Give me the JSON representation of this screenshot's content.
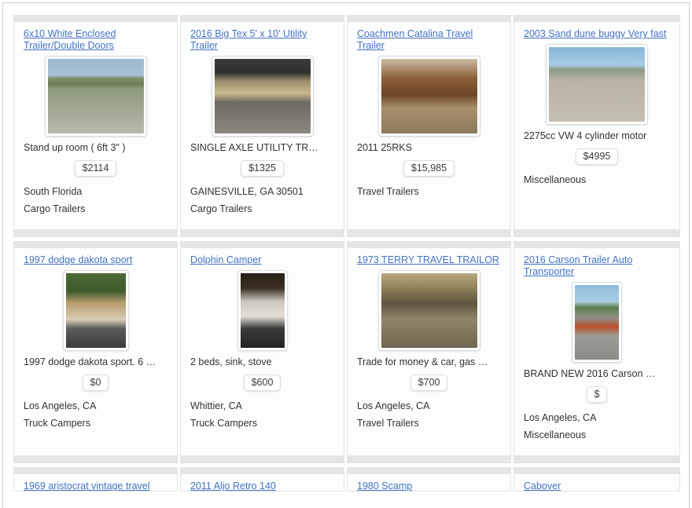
{
  "page": {
    "layout": "classifieds-grid",
    "columns": 4,
    "accent_link_color": "#4573c4",
    "card_bar_color": "#e5e5e5",
    "card_background": "#fcfdfd"
  },
  "rows": [
    {
      "cards": [
        {
          "title": "6x10 White Enclosed Trailer/Double Doors",
          "description": "Stand up room ( 6ft 3\" )",
          "price": "$2114",
          "location": "South Florida",
          "category": "Cargo Trailers",
          "thumb_alt": "white-enclosed-cargo-trailer-photo",
          "thumb_w": 122,
          "thumb_h": 95
        },
        {
          "title": "2016 Big Tex 5' x 10' Utility Trailer",
          "description": "SINGLE AXLE UTILITY TR…",
          "price": "$1325",
          "location": "GAINESVILLE, GA 30501",
          "category": "Cargo Trailers",
          "thumb_alt": "big-tex-utility-trailer-photo",
          "thumb_w": 122,
          "thumb_h": 95
        },
        {
          "title": "Coachmen Catalina Travel Trailer",
          "description": "2011 25RKS",
          "price": "$15,985",
          "location": "",
          "category": "Travel Trailers",
          "thumb_alt": "travel-trailer-interior-photo",
          "thumb_w": 122,
          "thumb_h": 95
        },
        {
          "title": "2003 Sand dune buggy Very fast",
          "description": "2275cc VW 4 cylinder motor",
          "price": "$4995",
          "location": "",
          "category": "Miscellaneous",
          "thumb_alt": "sand-dune-buggy-photo",
          "thumb_w": 122,
          "thumb_h": 95
        }
      ]
    },
    {
      "cards": [
        {
          "title": "1997 dodge dakota sport",
          "description": "1997 dodge dakota sport. 6 …",
          "price": "$0",
          "location": "Los Angeles, CA",
          "category": "Truck Campers",
          "thumb_alt": "dodge-dakota-truck-camper-photo",
          "thumb_w": 76,
          "thumb_h": 95
        },
        {
          "title": "Dolphin Camper",
          "description": "2 beds, sink, stove",
          "price": "$600",
          "location": "Whittier, CA",
          "category": "Truck Campers",
          "thumb_alt": "dolphin-camper-photo",
          "thumb_w": 56,
          "thumb_h": 95
        },
        {
          "title": "1973 TERRY TRAVEL TRAILOR",
          "description": "Trade for money & car, gas …",
          "price": "$700",
          "location": "Los Angeles, CA",
          "category": "Travel Trailers",
          "thumb_alt": "terry-travel-trailer-kitchen-photo",
          "thumb_w": 122,
          "thumb_h": 95
        },
        {
          "title": "2016 Carson Trailer Auto Transporter",
          "description": "BRAND NEW 2016 Carson …",
          "price": "$",
          "location": "Los Angeles, CA",
          "category": "Miscellaneous",
          "thumb_alt": "carson-auto-transporter-trailer-photo",
          "thumb_w": 56,
          "thumb_h": 95
        }
      ]
    },
    {
      "partial": true,
      "cards": [
        {
          "title": "1969 aristocrat vintage travel",
          "description": "",
          "price": "",
          "location": "",
          "category": "",
          "thumb_alt": "",
          "thumb_w": 0,
          "thumb_h": 0
        },
        {
          "title": "2011 Aljo Retro 140",
          "description": "",
          "price": "",
          "location": "",
          "category": "",
          "thumb_alt": "",
          "thumb_w": 0,
          "thumb_h": 0
        },
        {
          "title": "1980 Scamp",
          "description": "",
          "price": "",
          "location": "",
          "category": "",
          "thumb_alt": "",
          "thumb_w": 0,
          "thumb_h": 0
        },
        {
          "title": "Cabover",
          "description": "",
          "price": "",
          "location": "",
          "category": "",
          "thumb_alt": "",
          "thumb_w": 0,
          "thumb_h": 0
        }
      ]
    }
  ]
}
